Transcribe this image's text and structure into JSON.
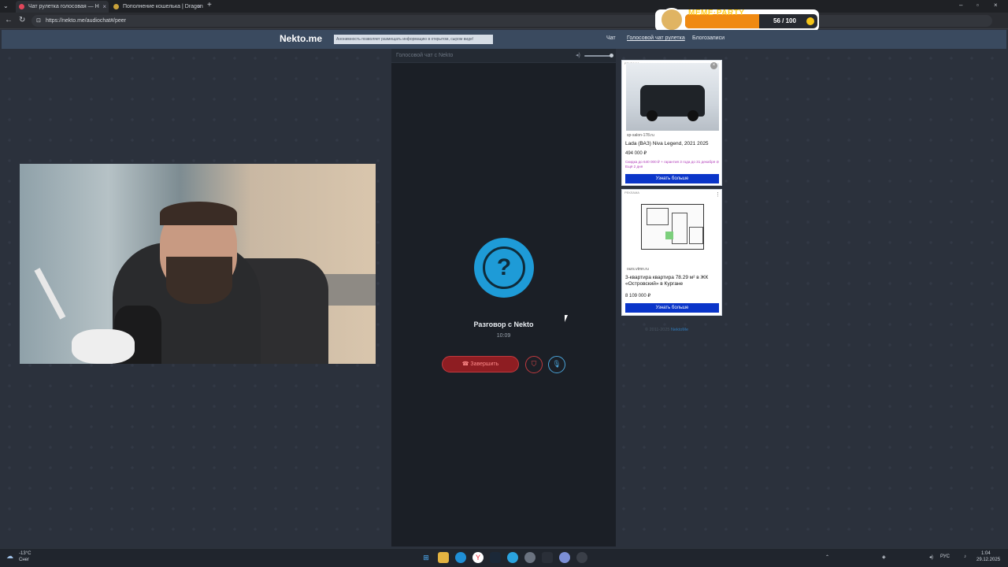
{
  "browser": {
    "tabs": [
      {
        "title": "Чат рулетка голосовая — Н"
      },
      {
        "title": "Пополнение кошелька | Dragon"
      }
    ],
    "url": "https://nekto.me/audiochat#/peer"
  },
  "overlay": {
    "title": "MEME·PARTY",
    "score": "56 / 100",
    "progress": 0.56
  },
  "site": {
    "logo": "Nekto.me",
    "notice": "Анонимность позволяет размещать информацию в открытом, сыром виде!",
    "nav": [
      "Чат",
      "Голосовой чат рулетка",
      "Блогозаписи"
    ]
  },
  "chat": {
    "panel_title": "Голосовой чат с Nekto",
    "icon": "question-mark-icon",
    "conversation_title": "Разговор с Nekto",
    "timer": "10:09",
    "end_button": "Завершить"
  },
  "ads": [
    {
      "label": "РЕКЛАМА",
      "domain": "sp-salon-178.ru",
      "title": "Lada (ВАЗ) Niva Legend, 2021 2025",
      "price": "494 000 ₽",
      "note": "Скидка до 640 000 ₽ + гарантия 3 года до 31 декабря ⊘ Ещё 2 дня",
      "button": "Узнать больше"
    },
    {
      "label": "РЕКЛАМА",
      "domain": "ours.vtmn.ru",
      "title": "3-квартира квартира 78.29 м² в ЖК «Островский» в Кургане",
      "price": "8 109 000 ₽",
      "button": "Узнать больше"
    }
  ],
  "footer": {
    "copyright": "© 2011-2025",
    "link": "NektoMe"
  },
  "taskbar": {
    "weather": "-13°C",
    "weather_desc": "Снег",
    "lang": "РУС",
    "time": "1:04",
    "date": "29.12.2025"
  }
}
